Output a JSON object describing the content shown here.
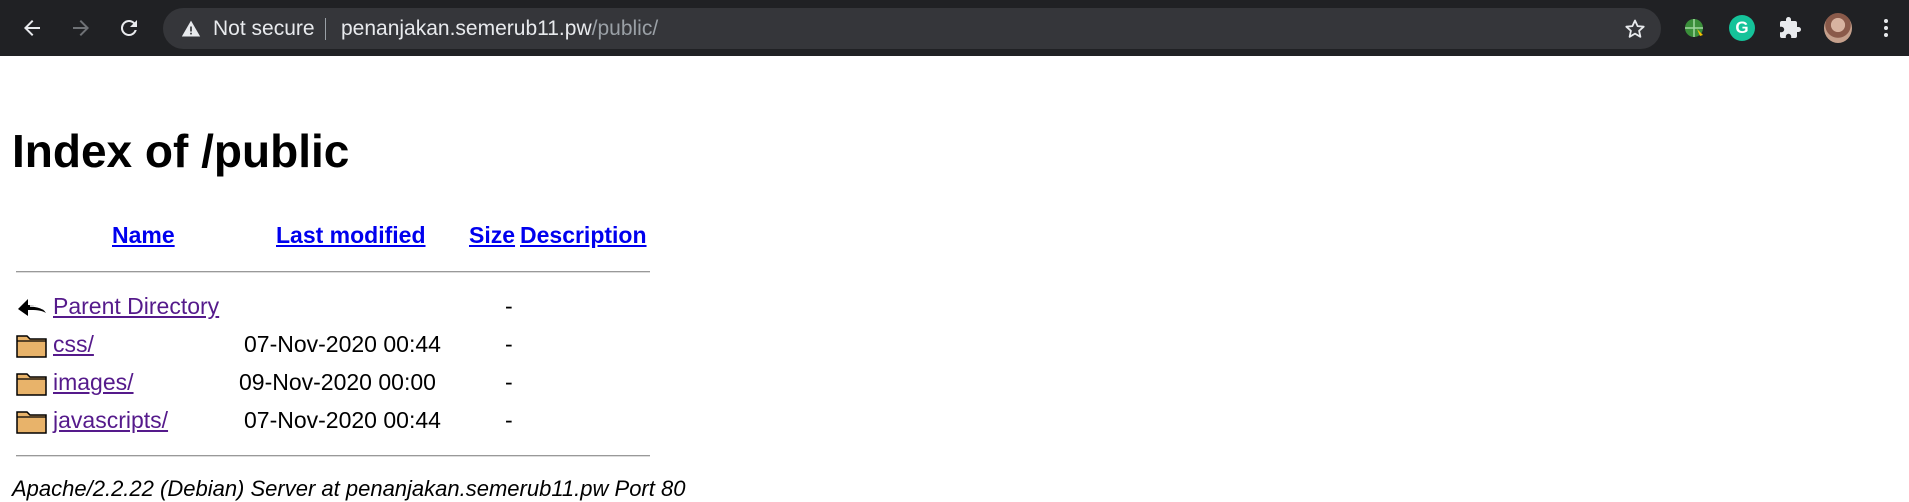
{
  "browser": {
    "security_label": "Not secure",
    "url_host": "penanjakan.semerub11.pw",
    "url_path": "/public/",
    "grammarly_letter": "G"
  },
  "page": {
    "title": "Index of /public",
    "columns": {
      "name": "Name",
      "last_modified": "Last modified",
      "size": "Size",
      "description": "Description"
    },
    "rows": [
      {
        "icon": "back-arrow-icon",
        "name": "Parent Directory",
        "modified": "",
        "size": "-"
      },
      {
        "icon": "folder-icon",
        "name": "css/",
        "modified": "07-Nov-2020 00:44",
        "size": "-"
      },
      {
        "icon": "folder-icon",
        "name": "images/",
        "modified": "09-Nov-2020 00:00",
        "size": "-"
      },
      {
        "icon": "folder-icon",
        "name": "javascripts/",
        "modified": "07-Nov-2020 00:44",
        "size": "-"
      }
    ],
    "footer": "Apache/2.2.22 (Debian) Server at penanjakan.semerub11.pw Port 80"
  },
  "colors": {
    "link": "#0000ee",
    "visited": "#551a8b",
    "chrome_bg": "#202124",
    "omnibox_bg": "#35363a"
  }
}
